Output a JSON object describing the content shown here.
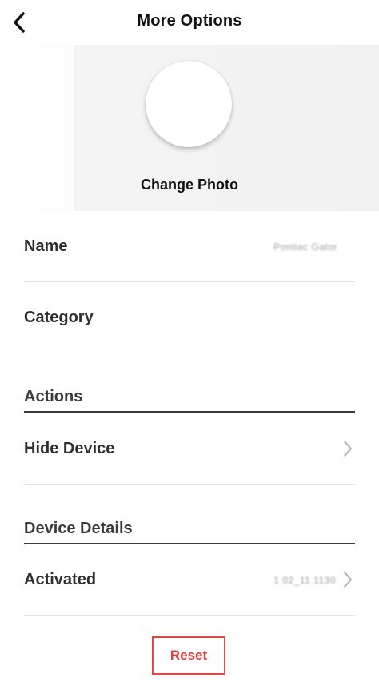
{
  "header": {
    "title": "More Options",
    "back_icon": "chevron-left-icon"
  },
  "photo": {
    "change_label": "Change Photo"
  },
  "fields": {
    "name_label": "Name",
    "name_value": "Pontiac Gator",
    "category_label": "Category"
  },
  "actions_section": {
    "title": "Actions",
    "hide_device_label": "Hide Device"
  },
  "details_section": {
    "title": "Device Details",
    "activated_label": "Activated",
    "activated_value": "1 02_11 1130"
  },
  "reset": {
    "label": "Reset"
  },
  "colors": {
    "accent_red": "#e23b3b",
    "text_dark": "#2f2f2f",
    "divider": "#e2e2e2"
  }
}
